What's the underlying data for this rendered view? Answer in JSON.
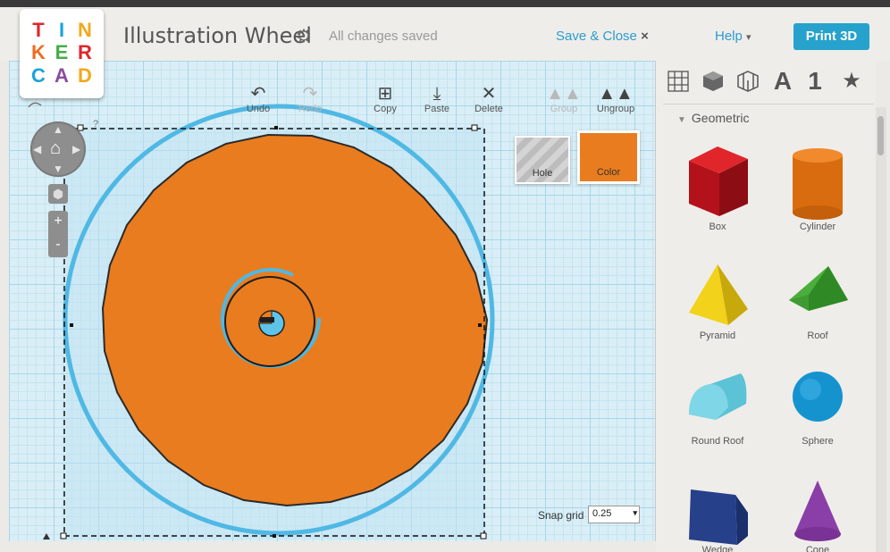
{
  "logo": {
    "letters": [
      "T",
      "I",
      "N",
      "K",
      "E",
      "R",
      "C",
      "A",
      "D"
    ],
    "colors": [
      "#e0262b",
      "#1aa3d9",
      "#f3a81c",
      "#ed6d22",
      "#45ad47",
      "#e0262b",
      "#1aa3d9",
      "#8a4b9e",
      "#f3a81c"
    ]
  },
  "header": {
    "title": "Illustration Wheel",
    "status": "All changes saved",
    "save_close": "Save & Close",
    "close_glyph": "×",
    "help": "Help",
    "help_caret": "▾",
    "print_button": "Print 3D"
  },
  "toolbar": {
    "undo": "Undo",
    "redo": "Redo",
    "copy": "Copy",
    "paste": "Paste",
    "delete": "Delete",
    "group": "Group",
    "ungroup": "Ungroup",
    "help_mark": "?"
  },
  "swatches": {
    "hole": "Hole",
    "color": "Color",
    "color_hex": "#e97c1f"
  },
  "zoom": {
    "plus": "+",
    "minus": "-"
  },
  "snap": {
    "label": "Snap grid",
    "value": "0.25"
  },
  "shapes_panel": {
    "category_icons": [
      "grid-icon",
      "cube-icon",
      "cage-icon",
      "letter-a-icon",
      "number-one-icon",
      "star-icon"
    ],
    "category_glyphs": {
      "letter": "A",
      "number": "1",
      "star": "★"
    },
    "section": "Geometric",
    "items": [
      "Box",
      "Cylinder",
      "Pyramid",
      "Roof",
      "Round Roof",
      "Sphere",
      "Wedge",
      "Cone"
    ]
  }
}
